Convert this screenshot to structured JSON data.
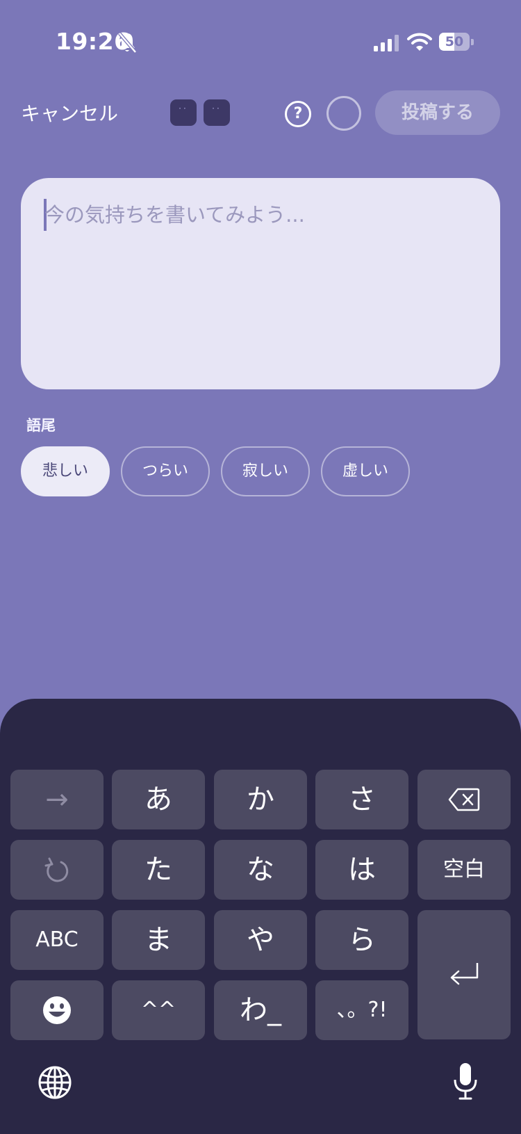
{
  "status_bar": {
    "time": "19:26",
    "battery": "50",
    "battery_percent": 50
  },
  "header": {
    "cancel_label": "キャンセル",
    "help_icon": "?",
    "post_label": "投稿する"
  },
  "editor": {
    "placeholder": "今の気持ちを書いてみよう..."
  },
  "suffix": {
    "label": "語尾",
    "options": [
      "悲しい",
      "つらい",
      "寂しい",
      "虚しい"
    ],
    "selected": "悲しい"
  },
  "keyboard": {
    "row1": [
      "→",
      "あ",
      "か",
      "さ"
    ],
    "row2": [
      "た",
      "な",
      "は",
      "空白"
    ],
    "row3": [
      "ABC",
      "ま",
      "や",
      "ら"
    ],
    "row4": [
      "^^",
      "わ_",
      "、。?!"
    ]
  },
  "icons": [
    "bell-slash-icon",
    "signal-icon",
    "wifi-icon",
    "battery-icon",
    "help-icon",
    "undo-icon",
    "delete-icon",
    "enter-icon",
    "emoji-icon",
    "globe-icon",
    "mic-icon"
  ],
  "colors": {
    "background": "#7b77b8",
    "card": "#e7e5f5",
    "keyboard": "#2a2745",
    "key": "#4c4a62"
  }
}
